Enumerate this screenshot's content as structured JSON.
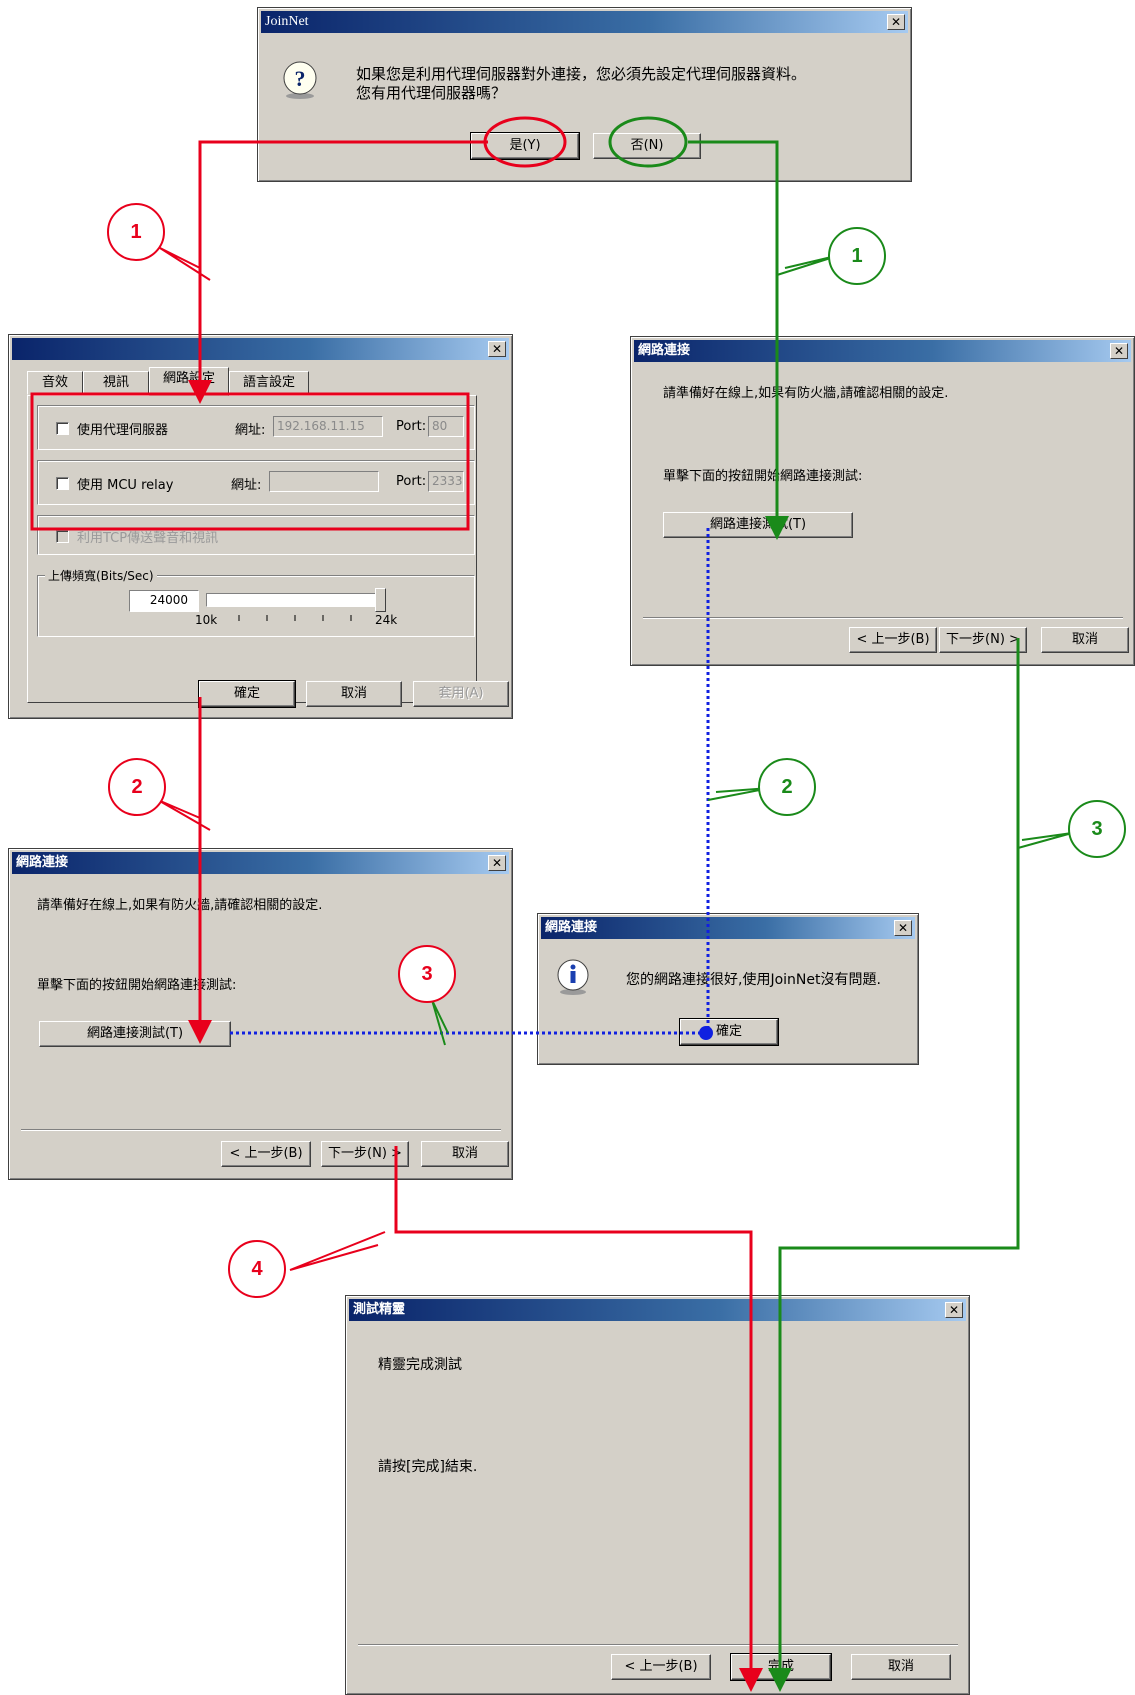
{
  "colors": {
    "red_flow": "#e8001c",
    "green_flow": "#1a8a1a",
    "blue_flow": "#1020e0",
    "title_bar": "#0a246a"
  },
  "joinnet_dialog": {
    "title": "JoinNet",
    "message_line1": "如果您是利用代理伺服器對外連接，您必須先設定代理伺服器資料。",
    "message_line2": "您有用代理伺服器嗎？",
    "yes_label": "是(Y)",
    "no_label": "否(N)",
    "icon": "question-icon"
  },
  "settings_dialog": {
    "tabs": [
      "音效",
      "視訊",
      "網路設定",
      "語言設定"
    ],
    "proxy_label": "使用代理伺服器",
    "proxy_addr_label": "網址:",
    "proxy_addr_value": "192.168.11.15",
    "proxy_port_label": "Port:",
    "proxy_port_value": "80",
    "mcu_label": "使用 MCU relay",
    "mcu_addr_label": "網址:",
    "mcu_addr_value": "",
    "mcu_port_label": "Port:",
    "mcu_port_value": "2333",
    "tcp_label": "利用TCP傳送聲音和視訊",
    "bandwidth_group": "上傳頻寬(Bits/Sec)",
    "bandwidth_value": "24000",
    "slider_min": "10k",
    "slider_max": "24k",
    "slider_level": 1.0,
    "ok_label": "確定",
    "cancel_label": "取消",
    "apply_label": "套用(A)"
  },
  "network_wizard": {
    "title": "網路連接",
    "line1": "請準備好在線上,如果有防火牆,請確認相關的設定.",
    "line2": "單擊下面的按鈕開始網路連接測試:",
    "test_button": "網路連接測試(T)",
    "back_label": "< 上一步(B)",
    "next_label": "下一步(N) >",
    "cancel_label": "取消"
  },
  "info_dialog": {
    "title": "網路連接",
    "message": "您的網路連接很好,使用JoinNet沒有問題.",
    "ok_label": "確定",
    "icon": "info-icon"
  },
  "finish_wizard": {
    "title": "測試精靈",
    "line1": "精靈完成測試",
    "line2": "請按[完成]結束.",
    "back_label": "< 上一步(B)",
    "finish_label": "完成",
    "cancel_label": "取消"
  },
  "badges": {
    "red_1": "1",
    "green_1": "1",
    "red_2": "2",
    "blue_2": "2",
    "blue_3": "3",
    "green_3": "3",
    "red_4": "4"
  }
}
